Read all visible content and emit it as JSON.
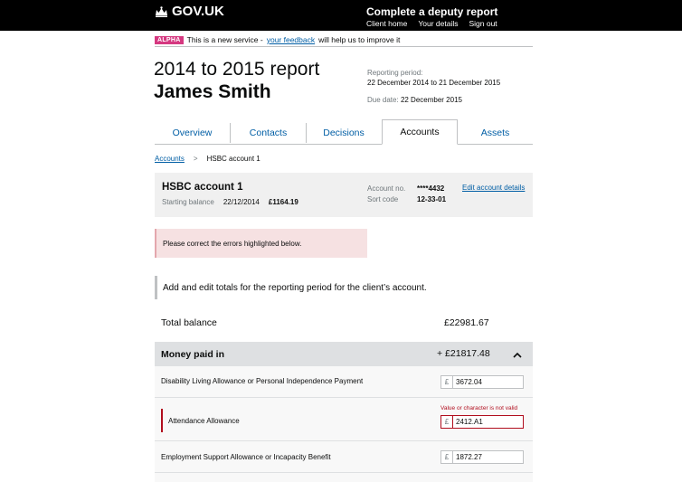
{
  "header": {
    "logo_text": "GOV.UK",
    "service_name": "Complete a deputy report",
    "nav": [
      "Client home",
      "Your details",
      "Sign out"
    ]
  },
  "phase_banner": {
    "tag": "ALPHA",
    "text_before": "This is a new service -",
    "link": "your feedback",
    "text_after": "will help us to improve it"
  },
  "report": {
    "title": "2014 to 2015 report",
    "client_name": "James Smith",
    "period_label": "Reporting period:",
    "period_value": "22 December 2014 to 21 December 2015",
    "due_label": "Due date:",
    "due_value": "22 December 2015"
  },
  "tabs": [
    {
      "label": "Overview",
      "active": false
    },
    {
      "label": "Contacts",
      "active": false
    },
    {
      "label": "Decisions",
      "active": false
    },
    {
      "label": "Accounts",
      "active": true
    },
    {
      "label": "Assets",
      "active": false
    }
  ],
  "breadcrumb": {
    "link": "Accounts",
    "separator": ">",
    "current": "HSBC account 1"
  },
  "account": {
    "name": "HSBC account 1",
    "starting_label": "Starting balance",
    "starting_date": "22/12/2014",
    "starting_amount": "£1164.19",
    "account_no_label": "Account no.",
    "account_no": "****4432",
    "sort_code_label": "Sort code",
    "sort_code": "12-33-01",
    "edit_link": "Edit account details"
  },
  "error_summary": "Please correct the errors highlighted below.",
  "intro": "Add and edit totals for the reporting period for the client’s account.",
  "total": {
    "label": "Total balance",
    "value": "£22981.67"
  },
  "money_in": {
    "label": "Money paid in",
    "total": "+ £21817.48",
    "rows": [
      {
        "label": "Disability Living Allowance or Personal Independence Payment",
        "currency": "£",
        "value": "3672.04",
        "error": ""
      },
      {
        "label": "Attendance Allowance",
        "currency": "£",
        "value": "2412.A1",
        "error": "Value or character is not valid"
      },
      {
        "label": "Employment Support Allowance or Incapacity Benefit",
        "currency": "£",
        "value": "1872.27",
        "error": ""
      }
    ]
  }
}
